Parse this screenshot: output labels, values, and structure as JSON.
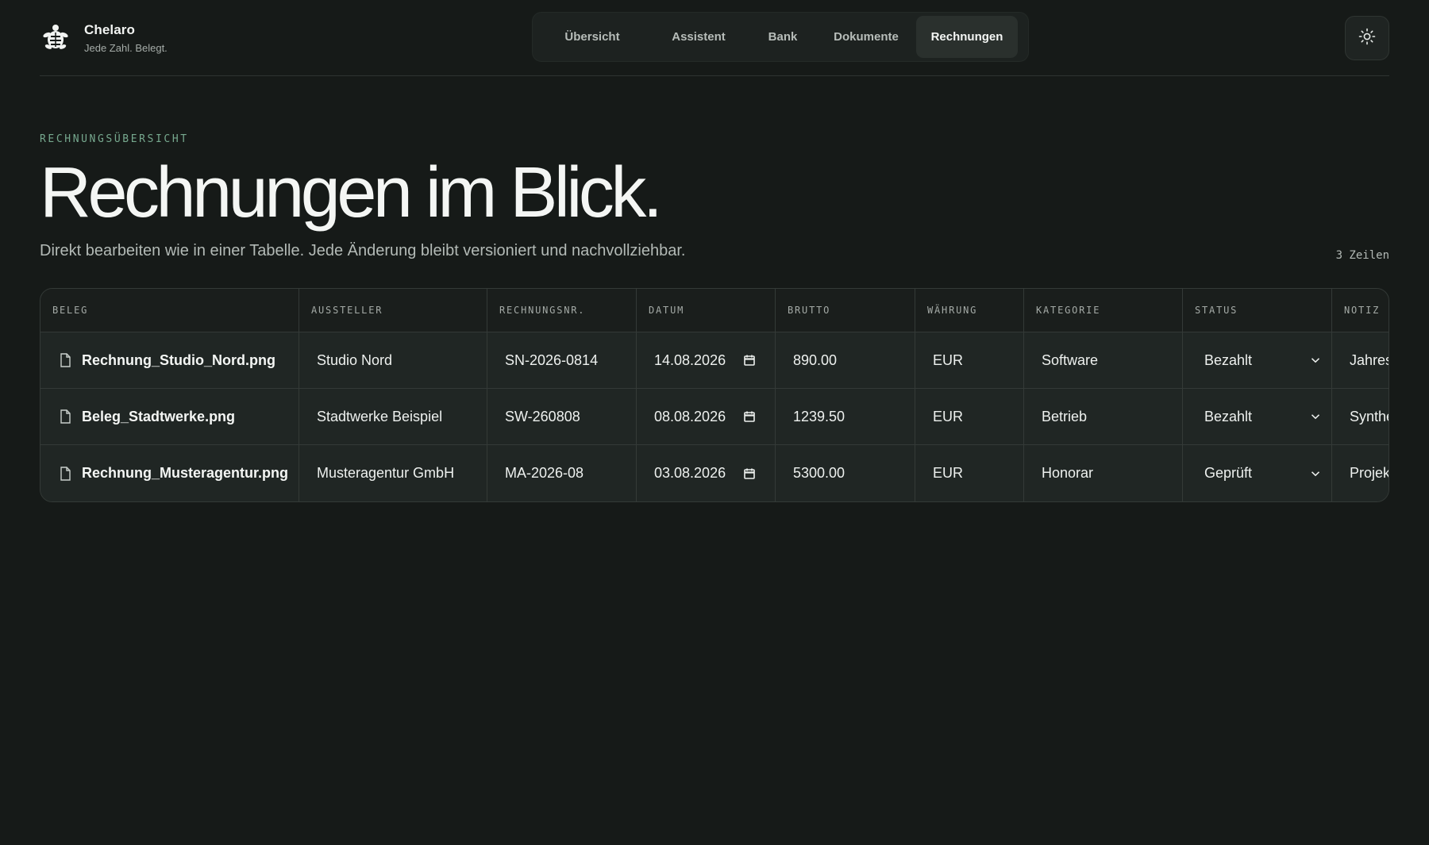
{
  "brand": {
    "name": "Chelaro",
    "tagline": "Jede Zahl. Belegt."
  },
  "nav": {
    "items": [
      {
        "label": "Übersicht",
        "active": false
      },
      {
        "label": "Assistent",
        "active": false
      },
      {
        "label": "Bank",
        "active": false
      },
      {
        "label": "Dokumente",
        "active": false
      },
      {
        "label": "Rechnungen",
        "active": true
      }
    ]
  },
  "theme_toggle": {
    "icon": "sun-icon"
  },
  "hero": {
    "eyebrow": "RECHNUNGSÜBERSICHT",
    "title": "Rechnungen im Blick.",
    "subtitle": "Direkt bearbeiten wie in einer Tabelle. Jede Änderung bleibt versioniert und nachvollziehbar.",
    "row_count": "3 Zeilen"
  },
  "table": {
    "columns": [
      "BELEG",
      "AUSSTELLER",
      "RECHNUNGSNR.",
      "DATUM",
      "BRUTTO",
      "WÄHRUNG",
      "KATEGORIE",
      "STATUS",
      "NOTIZ"
    ],
    "rows": [
      {
        "file": "Rechnung_Studio_Nord.png",
        "issuer": "Studio Nord",
        "number": "SN-2026-0814",
        "date": "14.08.2026",
        "gross": "890.00",
        "currency": "EUR",
        "category": "Software",
        "status": "Bezahlt",
        "note": "Jahres"
      },
      {
        "file": "Beleg_Stadtwerke.png",
        "issuer": "Stadtwerke Beispiel",
        "number": "SW-260808",
        "date": "08.08.2026",
        "gross": "1239.50",
        "currency": "EUR",
        "category": "Betrieb",
        "status": "Bezahlt",
        "note": "Synthe"
      },
      {
        "file": "Rechnung_Musteragentur.png",
        "issuer": "Musteragentur GmbH",
        "number": "MA-2026-08",
        "date": "03.08.2026",
        "gross": "5300.00",
        "currency": "EUR",
        "category": "Honorar",
        "status": "Geprüft",
        "note": "Projek"
      }
    ]
  },
  "colors": {
    "background": "#161a18",
    "accent": "#76a88e",
    "table_bg": "#202624",
    "border": "#343a37"
  }
}
